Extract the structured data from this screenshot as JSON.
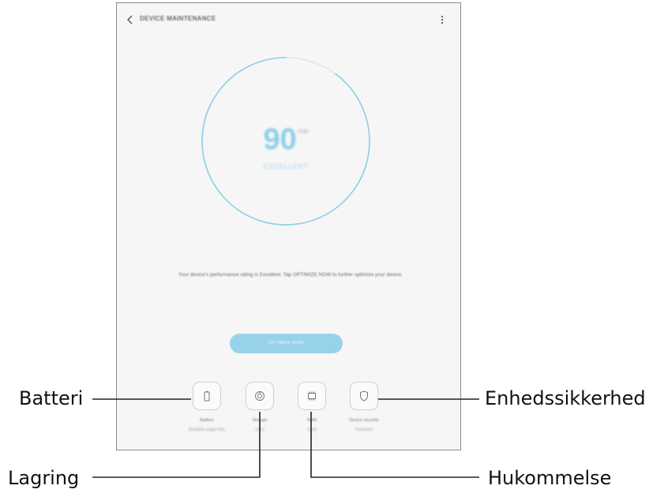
{
  "app": {
    "title": "DEVICE MAINTENANCE"
  },
  "score": {
    "value": "90",
    "max": "/100",
    "status": "EXCELLENT",
    "ring_color": "#8ecfe8"
  },
  "description": "Your device's performance rating is Excellent. Tap OPTIMIZE NOW to further optimize your device.",
  "optimize_button": {
    "label": "OPTIMIZE NOW",
    "color": "#97d2ea"
  },
  "items": [
    {
      "icon": "battery-icon",
      "label": "Battery",
      "sub": "Available usage time"
    },
    {
      "icon": "storage-icon",
      "label": "Storage",
      "sub": "Used"
    },
    {
      "icon": "memory-icon",
      "label": "RAM",
      "sub": "Used"
    },
    {
      "icon": "shield-icon",
      "label": "Device security",
      "sub": "Protected"
    }
  ],
  "callouts": {
    "battery": "Batteri",
    "storage": "Lagring",
    "memory": "Hukommelse",
    "security": "Enhedssikkerhed"
  }
}
